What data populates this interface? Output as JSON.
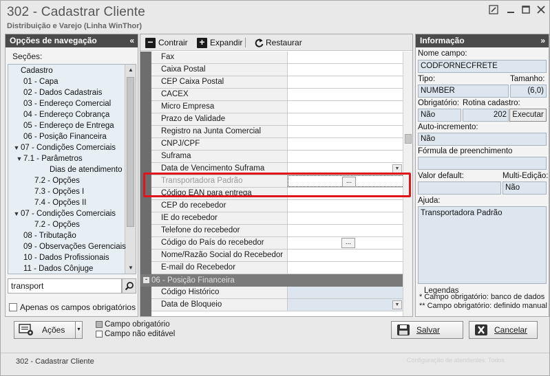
{
  "window": {
    "title": "302 - Cadastrar Cliente",
    "subtitle": "Distribuição e Varejo (Linha WinThor)",
    "controls": [
      "edit-icon",
      "minimize-icon",
      "maximize-icon",
      "close-icon"
    ]
  },
  "nav": {
    "header": "Opções de navegação",
    "collapse": "«",
    "sections_label": "Seções:",
    "tree": [
      {
        "label": "Cadastro",
        "indent": 0,
        "arrow": ""
      },
      {
        "label": "01 - Capa",
        "indent": 1,
        "arrow": ""
      },
      {
        "label": "02 - Dados Cadastrais",
        "indent": 1,
        "arrow": ""
      },
      {
        "label": "03 - Endereço Comercial",
        "indent": 1,
        "arrow": ""
      },
      {
        "label": "04 - Endereço Cobrança",
        "indent": 1,
        "arrow": ""
      },
      {
        "label": "05 - Endereço de Entrega",
        "indent": 1,
        "arrow": ""
      },
      {
        "label": "06 - Posição Financeira",
        "indent": 1,
        "arrow": ""
      },
      {
        "label": "07 - Condições Comerciais",
        "indent": 0,
        "arrow": "v"
      },
      {
        "label": "7.1 - Parâmetros",
        "indent": 1,
        "arrow": "v"
      },
      {
        "label": "Dias de atendimento",
        "indent": 3,
        "arrow": ""
      },
      {
        "label": "7.2 - Opções",
        "indent": 2,
        "arrow": ""
      },
      {
        "label": "7.3 - Opções I",
        "indent": 2,
        "arrow": ""
      },
      {
        "label": "7.4 - Opções II",
        "indent": 2,
        "arrow": ""
      },
      {
        "label": "07 - Condições Comerciais",
        "indent": 0,
        "arrow": "v"
      },
      {
        "label": "7.2 - Opções",
        "indent": 2,
        "arrow": ""
      },
      {
        "label": "08 - Tributação",
        "indent": 1,
        "arrow": ""
      },
      {
        "label": "09 - Observações Gerenciais",
        "indent": 1,
        "arrow": ""
      },
      {
        "label": "10 - Dados Profissionais",
        "indent": 1,
        "arrow": ""
      },
      {
        "label": "11 - Dados Cônjuge",
        "indent": 1,
        "arrow": ""
      }
    ],
    "search_value": "transport",
    "only_required_label": "Apenas os campos obrigatórios"
  },
  "toolbar": {
    "collapse_label": "Contrair",
    "expand_label": "Expandir",
    "restore_label": "Restaurar"
  },
  "grid": {
    "rows": [
      {
        "label": "Fax",
        "ellipsis": false,
        "blue": false
      },
      {
        "label": "Caixa Postal",
        "ellipsis": false,
        "blue": false
      },
      {
        "label": "CEP Caixa Postal",
        "ellipsis": false,
        "blue": false
      },
      {
        "label": "CACEX",
        "ellipsis": false,
        "blue": false
      },
      {
        "label": "Micro Empresa",
        "ellipsis": false,
        "blue": false
      },
      {
        "label": "Prazo de Validade",
        "ellipsis": false,
        "blue": false
      },
      {
        "label": "Registro na Junta Comercial",
        "ellipsis": false,
        "blue": false
      },
      {
        "label": "CNPJ/CPF",
        "ellipsis": false,
        "blue": false
      },
      {
        "label": "Suframa",
        "ellipsis": false,
        "blue": false
      },
      {
        "label": "Data de Vencimento Suframa",
        "ellipsis": false,
        "blue": false,
        "dropdown": true
      },
      {
        "label": "Transportadora Padrão",
        "ellipsis": true,
        "blue": false,
        "disabled": true,
        "selected": true
      },
      {
        "label": "Código EAN para entrega",
        "ellipsis": false,
        "blue": false
      },
      {
        "label": "CEP do recebedor",
        "ellipsis": false,
        "blue": false
      },
      {
        "label": "IE do recebedor",
        "ellipsis": false,
        "blue": false
      },
      {
        "label": "Telefone do recebedor",
        "ellipsis": false,
        "blue": false
      },
      {
        "label": "Código do País do recebedor",
        "ellipsis": true,
        "blue": false
      },
      {
        "label": "Nome/Razão Social do Recebedor",
        "ellipsis": false,
        "blue": false
      },
      {
        "label": "E-mail do Recebedor",
        "ellipsis": false,
        "blue": false
      }
    ],
    "section": "06 - Posição Financeira",
    "section_sign": "-",
    "rows_after": [
      {
        "label": "Código Histórico",
        "ellipsis": false,
        "blue": true
      },
      {
        "label": "Data de Bloqueio",
        "ellipsis": false,
        "blue": true,
        "dropdown": true
      }
    ],
    "ellipsis_text": "...",
    "dropdown_glyph": "▼"
  },
  "info": {
    "header": "Informação",
    "collapse": "»",
    "field_name_label": "Nome campo:",
    "field_name": "CODFORNECFRETE",
    "type_label": "Tipo:",
    "type": "NUMBER",
    "size_label": "Tamanho:",
    "size": "(6,0)",
    "required_label": "Obrigatório:",
    "required": "Não",
    "routine_label": "Rotina cadastro:",
    "routine": "202",
    "execute_label": "Executar",
    "autoinc_label": "Auto-incremento:",
    "autoinc": "Não",
    "formula_label": "Fórmula de preenchimento",
    "formula": "",
    "default_label": "Valor default:",
    "default_value": "",
    "multiedit_label": "Multi-Edição:",
    "multiedit": "Não",
    "help_label": "Ajuda:",
    "help": "Transportadora Padrão",
    "legend_title": "Legendas",
    "legend_1": "* Campo obrigatório: banco de dados",
    "legend_2": "** Campo obrigatório: definido manual"
  },
  "bottom": {
    "actions_label": "Ações",
    "required_legend": "Campo obrigatório",
    "noneditable_legend": "Campo não editável",
    "save_label": "Salvar",
    "cancel_label": "Cancelar"
  },
  "status": {
    "text": "302 - Cadastrar Cliente",
    "right_text": "Configuração de atendentes: Todos"
  },
  "colors": {
    "highlight": "#e0141b",
    "header_bg": "#4b4b4b",
    "field_bg": "#dde6ee"
  }
}
